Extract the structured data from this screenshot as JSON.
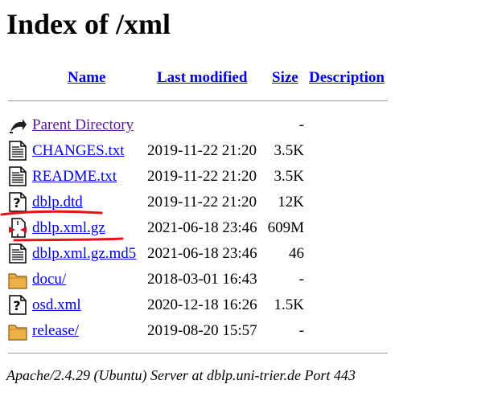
{
  "title": "Index of /xml",
  "columns": {
    "name": "Name",
    "last_modified": "Last modified",
    "size": "Size",
    "description": "Description"
  },
  "rows": [
    {
      "icon": "back-icon",
      "name": "Parent Directory",
      "date": "",
      "size": "-"
    },
    {
      "icon": "text-file-icon",
      "name": "CHANGES.txt",
      "date": "2019-11-22 21:20",
      "size": "3.5K"
    },
    {
      "icon": "text-file-icon",
      "name": "README.txt",
      "date": "2019-11-22 21:20",
      "size": "3.5K"
    },
    {
      "icon": "unknown-file-icon",
      "name": "dblp.dtd",
      "date": "2019-11-22 21:20",
      "size": "12K"
    },
    {
      "icon": "compressed-file-icon",
      "name": "dblp.xml.gz",
      "date": "2021-06-18 23:46",
      "size": "609M"
    },
    {
      "icon": "text-file-icon",
      "name": "dblp.xml.gz.md5",
      "date": "2021-06-18 23:46",
      "size": "46"
    },
    {
      "icon": "folder-icon",
      "name": "docu/",
      "date": "2018-03-01 16:43",
      "size": "-"
    },
    {
      "icon": "unknown-file-icon",
      "name": "osd.xml",
      "date": "2020-12-18 16:26",
      "size": "1.5K"
    },
    {
      "icon": "folder-icon",
      "name": "release/",
      "date": "2019-08-20 15:57",
      "size": "-"
    }
  ],
  "footer": "Apache/2.4.29 (Ubuntu) Server at dblp.uni-trier.de Port 443",
  "colors": {
    "link": "#0000ee",
    "visited_link": "#551a8b",
    "annotation": "#e8101a"
  }
}
